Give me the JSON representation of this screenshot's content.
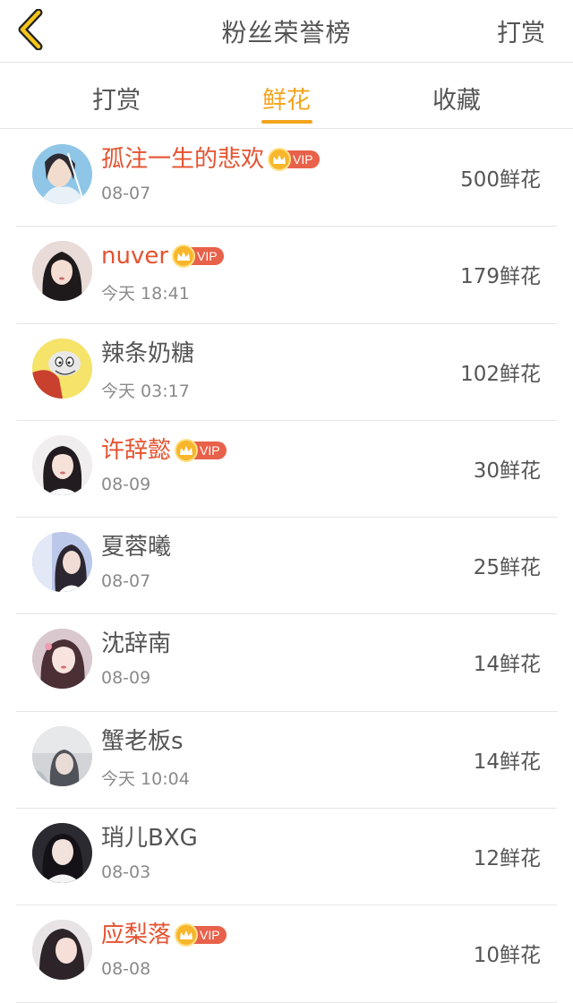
{
  "header": {
    "title": "粉丝荣誉榜",
    "action_label": "打赏",
    "back_icon": "chevron-left-icon",
    "accent_color": "#f3a51e"
  },
  "tabs": [
    {
      "label": "打赏",
      "active": false
    },
    {
      "label": "鲜花",
      "active": true
    },
    {
      "label": "收藏",
      "active": false
    }
  ],
  "vip_label": "VIP",
  "fans": [
    {
      "name": "孤注一生的悲欢",
      "vip": true,
      "time": "08-07",
      "amount": "500鲜花"
    },
    {
      "name": "nuver",
      "vip": true,
      "time": "今天 18:41",
      "amount": "179鲜花"
    },
    {
      "name": "辣条奶糖",
      "vip": false,
      "time": "今天 03:17",
      "amount": "102鲜花"
    },
    {
      "name": "许辞懿",
      "vip": true,
      "time": "08-09",
      "amount": "30鲜花"
    },
    {
      "name": "夏蓉曦",
      "vip": false,
      "time": "08-07",
      "amount": "25鲜花"
    },
    {
      "name": "沈辞南",
      "vip": false,
      "time": "08-09",
      "amount": "14鲜花"
    },
    {
      "name": "蟹老板s",
      "vip": false,
      "time": "今天 10:04",
      "amount": "14鲜花"
    },
    {
      "name": "琑儿BXG",
      "vip": false,
      "time": "08-03",
      "amount": "12鲜花"
    },
    {
      "name": "应梨落",
      "vip": true,
      "time": "08-08",
      "amount": "10鲜花"
    }
  ]
}
